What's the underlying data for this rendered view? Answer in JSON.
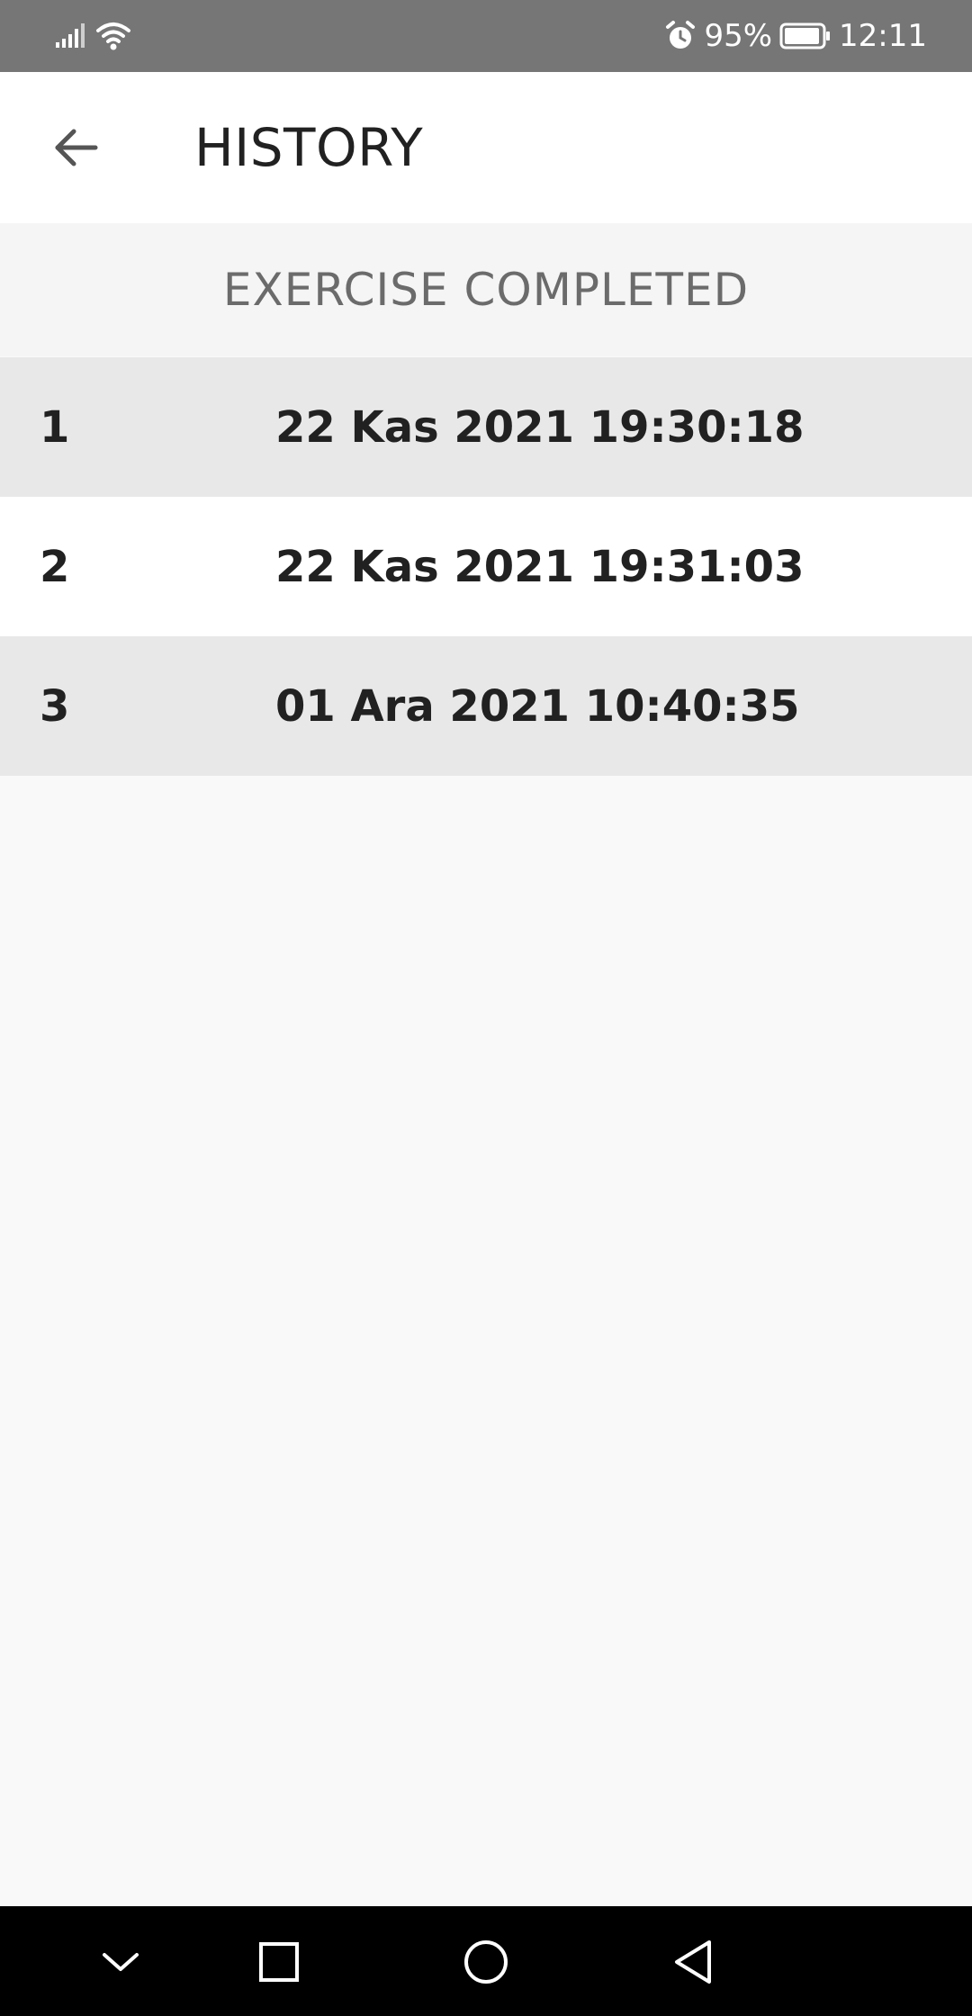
{
  "status_bar": {
    "battery_percent": "95%",
    "time": "12:11",
    "battery_level": 0.95,
    "icons": [
      "signal-icon",
      "wifi-icon",
      "alarm-icon",
      "battery-icon"
    ]
  },
  "toolbar": {
    "back_icon": "arrow-left-icon",
    "title": "HISTORY"
  },
  "section": {
    "header": "EXERCISE COMPLETED"
  },
  "history": [
    {
      "index": "1",
      "date": "22 Kas 2021 19:30:18"
    },
    {
      "index": "2",
      "date": "22 Kas 2021 19:31:03"
    },
    {
      "index": "3",
      "date": "01 Ara 2021 10:40:35"
    }
  ],
  "nav_bar": {
    "icons": [
      "chevron-down-icon",
      "recents-square-icon",
      "home-circle-icon",
      "back-triangle-icon"
    ]
  },
  "colors": {
    "status_bar_bg": "#767676",
    "toolbar_bg": "#ffffff",
    "row_shaded": "#e8e8e8",
    "row_plain": "#ffffff",
    "text_primary": "#212121",
    "text_secondary": "#6b6b6b",
    "nav_bar_bg": "#000000"
  }
}
